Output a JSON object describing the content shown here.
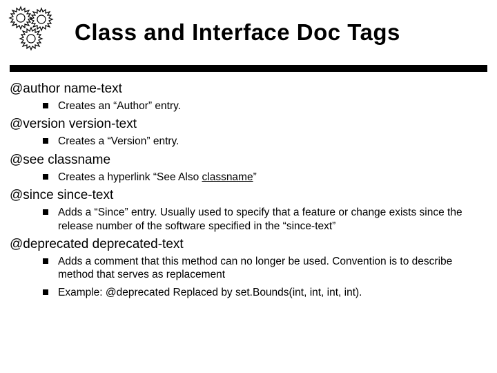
{
  "title": "Class and Interface Doc Tags",
  "sections": [
    {
      "heading": "@author name-text",
      "bullets": [
        {
          "text": "Creates an “Author” entry."
        }
      ]
    },
    {
      "heading": "@version version-text",
      "bullets": [
        {
          "text": "Creates a “Version” entry."
        }
      ]
    },
    {
      "heading": "@see classname",
      "bullets": [
        {
          "prefix": "Creates a hyperlink “See Also ",
          "underlined": "classname",
          "suffix": "”"
        }
      ]
    },
    {
      "heading": "@since since-text",
      "bullets": [
        {
          "text": "Adds a “Since” entry. Usually  used to specify that a feature or change exists since the release number of the software specified in the “since-text”"
        }
      ]
    },
    {
      "heading": "@deprecated deprecated-text",
      "bullets": [
        {
          "text": "Adds a comment that this method can no longer be used. Convention is to describe method that serves as replacement"
        },
        {
          "text": "Example: @deprecated  Replaced by set.Bounds(int, int, int, int)."
        }
      ]
    }
  ]
}
